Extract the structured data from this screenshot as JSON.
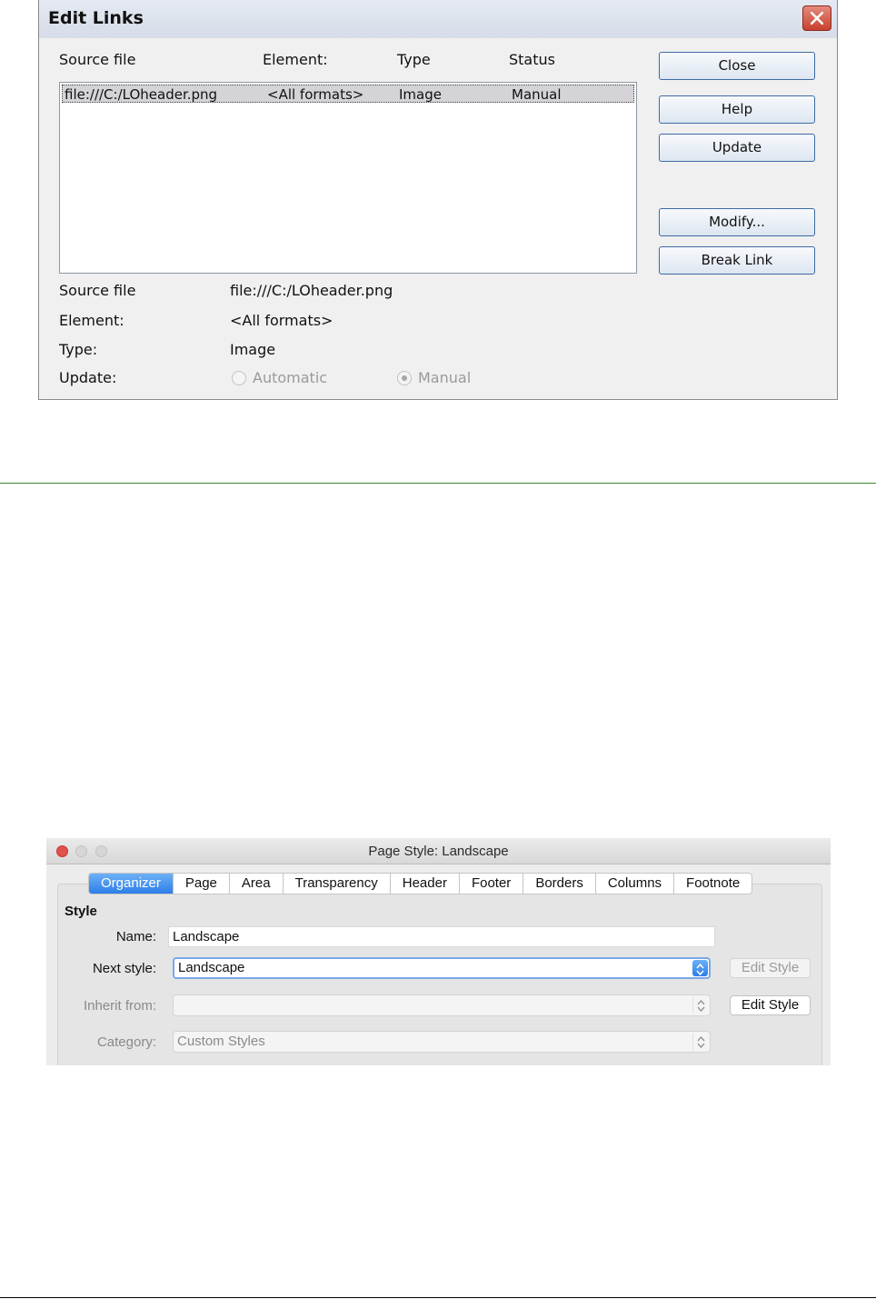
{
  "edit_links": {
    "title": "Edit Links",
    "columns": [
      "Source file",
      "Element:",
      "Type",
      "Status"
    ],
    "rows": [
      {
        "source": "file:///C:/LOheader.png",
        "element": "<All formats>",
        "type": "Image",
        "status": "Manual"
      }
    ],
    "buttons": {
      "close": "Close",
      "help": "Help",
      "update": "Update",
      "modify": "Modify...",
      "break_link": "Break Link"
    },
    "details": {
      "source_label": "Source file",
      "source_value": "file:///C:/LOheader.png",
      "element_label": "Element:",
      "element_value": "<All formats>",
      "type_label": "Type:",
      "type_value": "Image",
      "update_label": "Update:",
      "automatic": "Automatic",
      "manual": "Manual"
    }
  },
  "page_style": {
    "title": "Page Style: Landscape",
    "tabs": [
      "Organizer",
      "Page",
      "Area",
      "Transparency",
      "Header",
      "Footer",
      "Borders",
      "Columns",
      "Footnote"
    ],
    "active_tab": "Organizer",
    "section": "Style",
    "name_label": "Name:",
    "name_value": "Landscape",
    "next_style_label": "Next style:",
    "next_style_value": "Landscape",
    "inherit_label": "Inherit from:",
    "inherit_value": "",
    "category_label": "Category:",
    "category_value": "Custom Styles",
    "edit_style_1": "Edit Style",
    "edit_style_2": "Edit Style"
  },
  "colors": {
    "separator": "#3b8a2c",
    "mac_accent": "#2d7ee8",
    "win_close": "#c8412f"
  }
}
